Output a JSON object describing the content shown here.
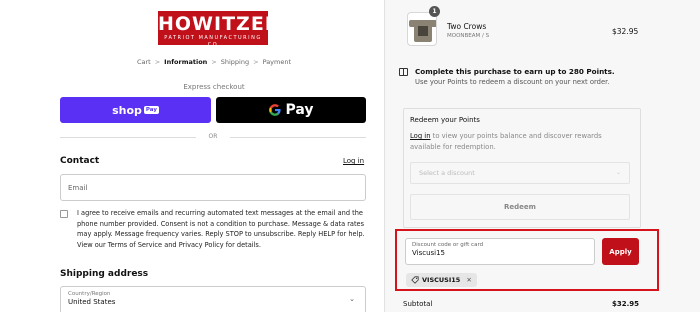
{
  "brand": {
    "name": "HOWITZER",
    "mark": "®",
    "tagline": "PATRIOT MANUFACTURING CO",
    "color": "#c0101a"
  },
  "breadcrumb": {
    "items": [
      "Cart",
      "Information",
      "Shipping",
      "Payment"
    ],
    "separator": ">"
  },
  "express": {
    "label": "Express checkout",
    "shop_label": "shop",
    "shop_badge": "Pay",
    "gpay_label": "Pay",
    "or_label": "OR",
    "shop_color": "#5a31f4"
  },
  "contact": {
    "heading": "Contact",
    "login_link": "Log in",
    "email_placeholder": "Email",
    "consent_text": "I agree to receive emails and recurring automated text messages at the email and the phone number provided. Consent is not a condition to purchase. Message & data rates may apply. Message frequency varies. Reply STOP to unsubscribe. Reply HELP for help. View our Terms of Service and Privacy Policy for details."
  },
  "shipping": {
    "heading": "Shipping address",
    "country_label": "Country/Region",
    "country_value": "United States"
  },
  "order": {
    "item_quantity": "1",
    "item_name": "Two Crows",
    "item_variant": "MOONBEAM / S",
    "item_price": "$32.95"
  },
  "points": {
    "title": "Complete this purchase to earn up to 280 Points.",
    "subtitle": "Use your Points to redeem a discount on your next order."
  },
  "redeem": {
    "title": "Redeem your Points",
    "login_link": "Log in",
    "text": "to view your points balance and discover rewards available for redemption.",
    "select_placeholder": "Select a discount",
    "button_label": "Redeem"
  },
  "discount": {
    "input_label": "Discount code or gift card",
    "input_value": "Viscusi15",
    "apply_label": "Apply",
    "applied_code": "VISCUSI15",
    "highlight_color": "#d8121b"
  },
  "summary": {
    "subtotal_label": "Subtotal",
    "subtotal_value": "$32.95"
  }
}
